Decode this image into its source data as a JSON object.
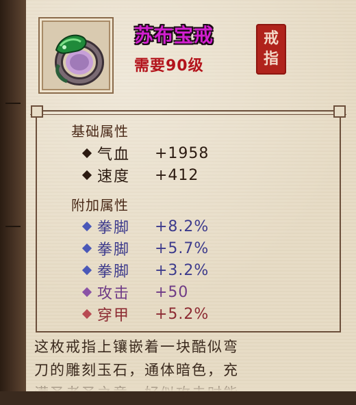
{
  "item": {
    "name": "苏布宝戒",
    "requirement": "需要90级",
    "category_seal": [
      "戒",
      "指"
    ],
    "icon": "green-jade-ring-icon"
  },
  "basic": {
    "title": "基础属性",
    "attrs": [
      {
        "name": "气血",
        "value": "+1958"
      },
      {
        "name": "速度",
        "value": "+412"
      }
    ]
  },
  "extra": {
    "title": "附加属性",
    "attrs": [
      {
        "name": "拳脚",
        "value": "+8.2%",
        "color": "#3c3a8c"
      },
      {
        "name": "拳脚",
        "value": "+5.7%",
        "color": "#3c3a8c"
      },
      {
        "name": "拳脚",
        "value": "+3.2%",
        "color": "#3c3a8c"
      },
      {
        "name": "攻击",
        "value": "+50",
        "color": "#6e3a86"
      },
      {
        "name": "穿甲",
        "value": "+5.2%",
        "color": "#8c2a32"
      }
    ]
  },
  "description": {
    "line1": "这枚戒指上镶嵌着一块酷似弯",
    "line2": "刀的雕刻玉石，通体暗色，充",
    "line3": "满圣者圣之意，好似攻击时能"
  },
  "colors": {
    "name": "#d11fcf",
    "requirement": "#b3131b",
    "basic_attr": "#2b1a10",
    "seal": "#b0231c"
  }
}
